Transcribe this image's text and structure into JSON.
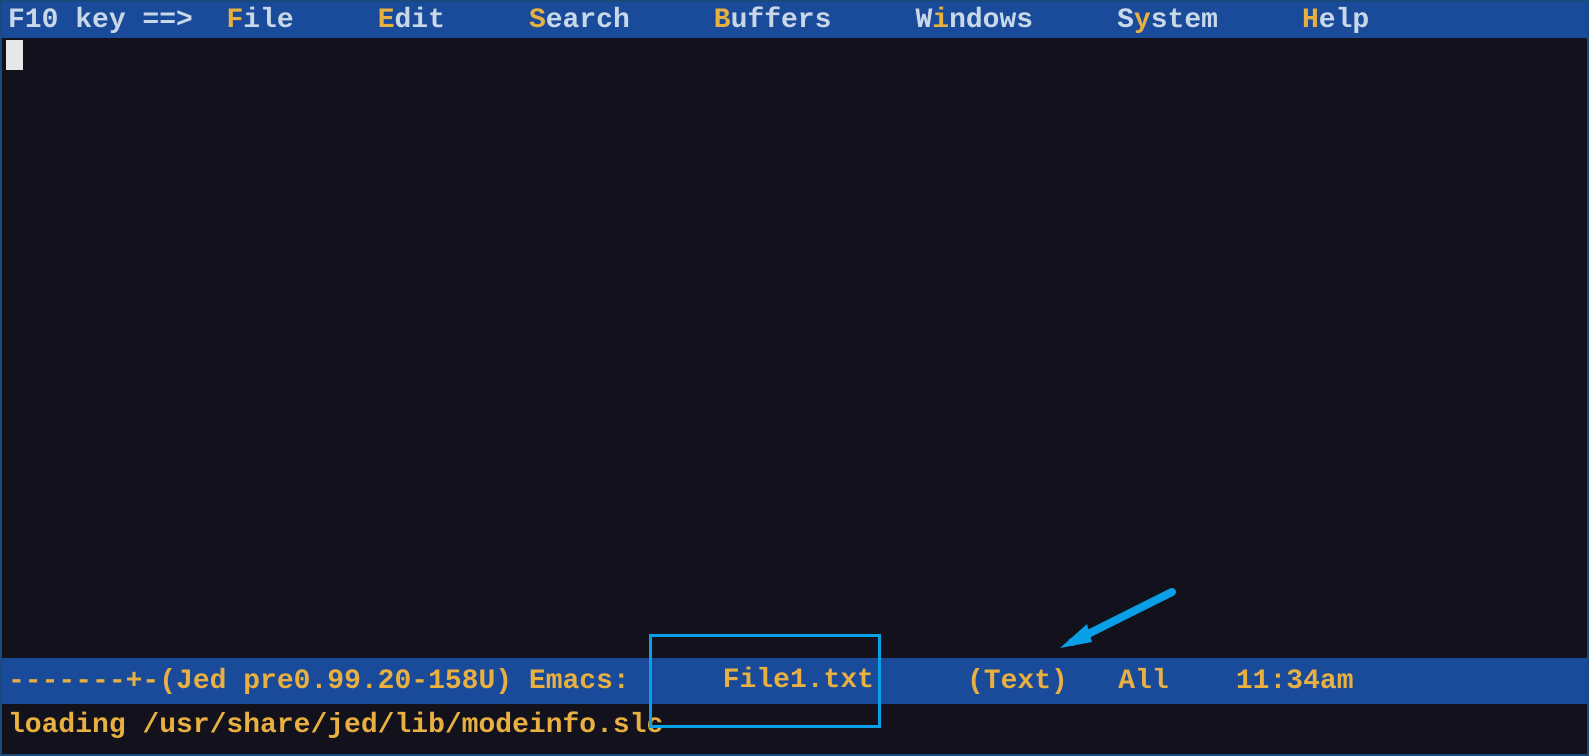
{
  "menubar": {
    "prefix": "F10 key ==>  ",
    "items": [
      {
        "hotkey": "F",
        "rest": "ile"
      },
      {
        "hotkey": "E",
        "rest": "dit"
      },
      {
        "hotkey": "S",
        "rest": "earch"
      },
      {
        "hotkey": "B",
        "rest": "uffers"
      },
      {
        "hotkey_pre": "W",
        "hotkey": "i",
        "rest": "ndows",
        "prefix_normal": "W"
      },
      {
        "hotkey_pre": "S",
        "hotkey": "y",
        "rest": "stem",
        "prefix_normal": "S"
      },
      {
        "hotkey": "H",
        "rest": "elp"
      }
    ],
    "gaps": [
      "    ",
      "    ",
      "    ",
      "    ",
      "    ",
      "    ",
      "    "
    ]
  },
  "status": {
    "dashes": "-------+-",
    "version": "(Jed pre0.99.20-158U)",
    "mode_label": " Emacs: ",
    "filename": "File1.txt",
    "mode": "(Text)",
    "position": "All",
    "time": "11:34am"
  },
  "minibuffer": {
    "message": "loading /usr/share/jed/lib/modeinfo.slc"
  }
}
